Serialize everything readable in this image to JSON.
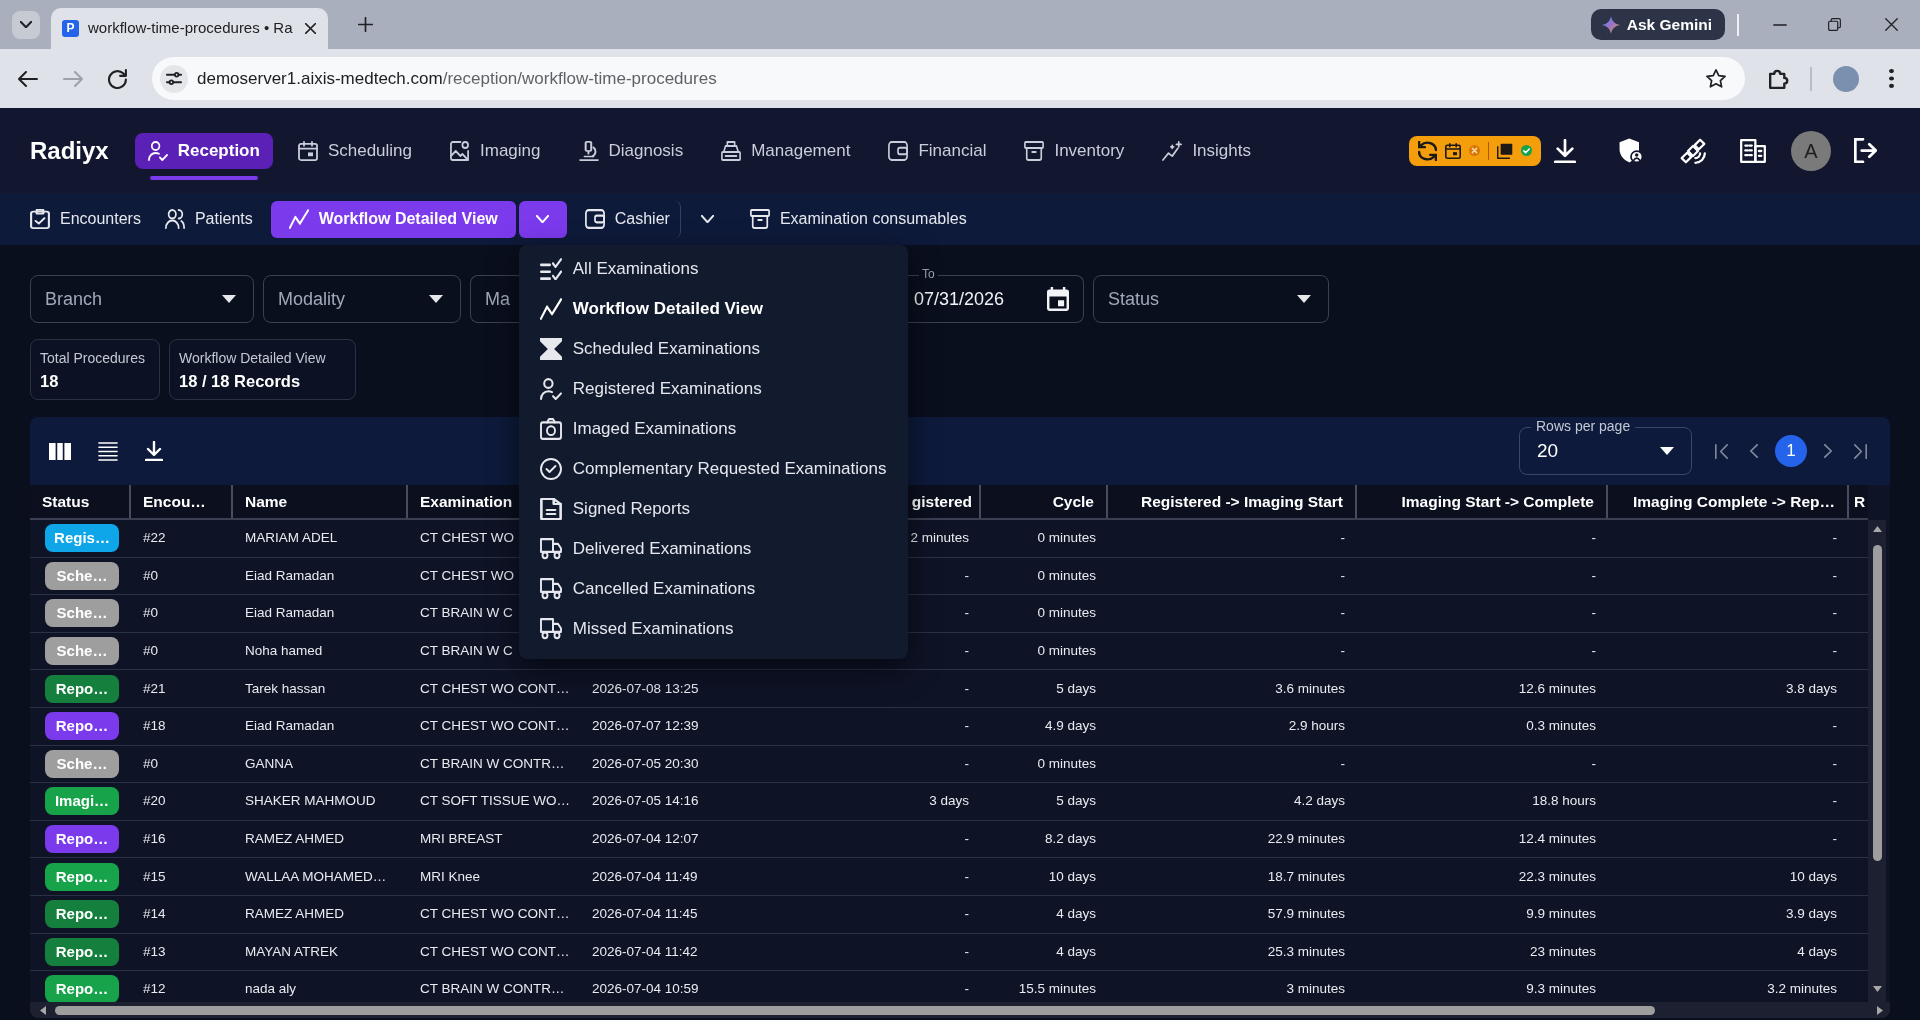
{
  "browser": {
    "tab": {
      "favicon": "P",
      "title": "workflow-time-procedures • Ra"
    },
    "assistant_button": "Ask Gemini",
    "nav_buttons": [
      {
        "kind": "back",
        "disabled": false
      },
      {
        "kind": "forward",
        "disabled": true
      },
      {
        "kind": "reload",
        "disabled": false
      }
    ],
    "address": {
      "host": "demoserver1.aixis-medtech.com",
      "path": "/reception/workflow-time-procedures"
    },
    "bookmarked": false
  },
  "app": {
    "brand": "Radiyx",
    "nav": [
      {
        "label": "Reception",
        "selected": true
      },
      {
        "label": "Scheduling",
        "selected": false
      },
      {
        "label": "Imaging",
        "selected": false
      },
      {
        "label": "Diagnosis",
        "selected": false
      },
      {
        "label": "Management",
        "selected": false
      },
      {
        "label": "Financial",
        "selected": false
      },
      {
        "label": "Inventory",
        "selected": false
      },
      {
        "label": "Insights",
        "selected": false
      }
    ],
    "service_status": [
      {
        "kind": "calendar",
        "ok": false
      },
      {
        "kind": "pdf",
        "ok": true
      }
    ],
    "user_initial": "A"
  },
  "subnav": [
    {
      "label": "Encounters",
      "kind": "link",
      "selected": false
    },
    {
      "label": "Patients",
      "kind": "link",
      "selected": false
    },
    {
      "label": "Workflow Detailed View",
      "kind": "split",
      "selected": true,
      "expanded": true,
      "menu": [
        {
          "label": "All Examinations",
          "selected": false
        },
        {
          "label": "Workflow Detailed View",
          "selected": true
        },
        {
          "label": "Scheduled Examinations",
          "selected": false
        },
        {
          "label": "Registered Examinations",
          "selected": false
        },
        {
          "label": "Imaged Examinations",
          "selected": false
        },
        {
          "label": "Complementary Requested Examinations",
          "selected": false
        },
        {
          "label": "Signed Reports",
          "selected": false
        },
        {
          "label": "Delivered Examinations",
          "selected": false
        },
        {
          "label": "Cancelled Examinations",
          "selected": false
        },
        {
          "label": "Missed Examinations",
          "selected": false
        }
      ]
    },
    {
      "label": "Cashier",
      "kind": "split",
      "selected": false,
      "expanded": false
    },
    {
      "label": "Examination consumables",
      "kind": "link",
      "selected": false
    }
  ],
  "filters": [
    {
      "kind": "select",
      "placeholder": "Branch"
    },
    {
      "kind": "select",
      "placeholder": "Modality"
    },
    {
      "kind": "select",
      "placeholder": "Ma"
    },
    {
      "kind": "date",
      "label": "To",
      "value": "07/31/2026"
    },
    {
      "kind": "select",
      "placeholder": "Status"
    }
  ],
  "summary": [
    {
      "label": "Total Procedures",
      "value": "18"
    },
    {
      "label": "Workflow Detailed View",
      "value": "18 / 18 Records"
    }
  ],
  "table": {
    "rows_per_page": {
      "label": "Rows per page",
      "value": "20"
    },
    "pages": [
      {
        "label": "1",
        "selected": true
      }
    ],
    "header": {
      "status": "Status",
      "encounter": "Encou…",
      "name": "Name",
      "examination": "Examination",
      "column_6": "gistered",
      "cycle": "Cycle",
      "registered_imaging_start": "Registered -> Imaging Start",
      "imaging_start_complete": "Imaging Start -> Complete",
      "imaging_complete_rep": "Imaging Complete -> Rep…",
      "column_11": "R"
    },
    "rows": [
      {
        "status": {
          "label": "Regis…",
          "color": "#0ea5e9"
        },
        "encounter": "#22",
        "name": "MARIAM ADEL",
        "examination": "CT CHEST WO",
        "column_6": "2 minutes",
        "cycle": "0 minutes",
        "registered_imaging_start": "-",
        "imaging_start_complete": "-",
        "imaging_complete_rep": "-"
      },
      {
        "status": {
          "label": "Sche…",
          "color": "#9e9e9e"
        },
        "encounter": "#0",
        "name": "Eiad Ramadan",
        "examination": "CT CHEST WO",
        "column_6": "-",
        "cycle": "0 minutes",
        "registered_imaging_start": "-",
        "imaging_start_complete": "-",
        "imaging_complete_rep": "-"
      },
      {
        "status": {
          "label": "Sche…",
          "color": "#9e9e9e"
        },
        "encounter": "#0",
        "name": "Eiad Ramadan",
        "examination": "CT BRAIN W C",
        "column_6": "-",
        "cycle": "0 minutes",
        "registered_imaging_start": "-",
        "imaging_start_complete": "-",
        "imaging_complete_rep": "-"
      },
      {
        "status": {
          "label": "Sche…",
          "color": "#9e9e9e"
        },
        "encounter": "#0",
        "name": "Noha hamed",
        "examination": "CT BRAIN W C",
        "column_6": "-",
        "cycle": "0 minutes",
        "registered_imaging_start": "-",
        "imaging_start_complete": "-",
        "imaging_complete_rep": "-"
      },
      {
        "status": {
          "label": "Repo…",
          "color": "#15803d"
        },
        "encounter": "#21",
        "name": "Tarek hassan",
        "examination": "CT CHEST WO CONT…",
        "column_5": "2026-07-08 13:25",
        "column_6": "-",
        "cycle": "5 days",
        "registered_imaging_start": "3.6 minutes",
        "imaging_start_complete": "12.6 minutes",
        "imaging_complete_rep": "3.8 days"
      },
      {
        "status": {
          "label": "Repo…",
          "color": "#7c3aed"
        },
        "encounter": "#18",
        "name": "Eiad Ramadan",
        "examination": "CT CHEST WO CONT…",
        "column_5": "2026-07-07 12:39",
        "column_6": "-",
        "cycle": "4.9 days",
        "registered_imaging_start": "2.9 hours",
        "imaging_start_complete": "0.3 minutes",
        "imaging_complete_rep": "-"
      },
      {
        "status": {
          "label": "Sche…",
          "color": "#9e9e9e"
        },
        "encounter": "#0",
        "name": "GANNA",
        "examination": "CT BRAIN W CONTR…",
        "column_5": "2026-07-05 20:30",
        "column_6": "-",
        "cycle": "0 minutes",
        "registered_imaging_start": "-",
        "imaging_start_complete": "-",
        "imaging_complete_rep": "-"
      },
      {
        "status": {
          "label": "Imagi…",
          "color": "#16a34a"
        },
        "encounter": "#20",
        "name": "SHAKER MAHMOUD",
        "examination": "CT SOFT TISSUE WO…",
        "column_5": "2026-07-05 14:16",
        "column_6": "3 days",
        "cycle": "5 days",
        "registered_imaging_start": "4.2 days",
        "imaging_start_complete": "18.8 hours",
        "imaging_complete_rep": "-"
      },
      {
        "status": {
          "label": "Repo…",
          "color": "#7c3aed"
        },
        "encounter": "#16",
        "name": "RAMEZ AHMED",
        "examination": "MRI BREAST",
        "column_5": "2026-07-04 12:07",
        "column_6": "-",
        "cycle": "8.2 days",
        "registered_imaging_start": "22.9 minutes",
        "imaging_start_complete": "12.4 minutes",
        "imaging_complete_rep": "-"
      },
      {
        "status": {
          "label": "Repo…",
          "color": "#16a34a"
        },
        "encounter": "#15",
        "name": "WALLAA MOHAMED…",
        "examination": "MRI Knee",
        "column_5": "2026-07-04 11:49",
        "column_6": "-",
        "cycle": "10 days",
        "registered_imaging_start": "18.7 minutes",
        "imaging_start_complete": "22.3 minutes",
        "imaging_complete_rep": "10 days"
      },
      {
        "status": {
          "label": "Repo…",
          "color": "#15803d"
        },
        "encounter": "#14",
        "name": "RAMEZ AHMED",
        "examination": "CT CHEST WO CONT…",
        "column_5": "2026-07-04 11:45",
        "column_6": "-",
        "cycle": "4 days",
        "registered_imaging_start": "57.9 minutes",
        "imaging_start_complete": "9.9 minutes",
        "imaging_complete_rep": "3.9 days"
      },
      {
        "status": {
          "label": "Repo…",
          "color": "#15803d"
        },
        "encounter": "#13",
        "name": "MAYAN ATREK",
        "examination": "CT CHEST WO CONT…",
        "column_5": "2026-07-04 11:42",
        "column_6": "-",
        "cycle": "4 days",
        "registered_imaging_start": "25.3 minutes",
        "imaging_start_complete": "23 minutes",
        "imaging_complete_rep": "4 days"
      },
      {
        "status": {
          "label": "Repo…",
          "color": "#16a34a"
        },
        "encounter": "#12",
        "name": "nada aly",
        "examination": "CT BRAIN W CONTR…",
        "column_5": "2026-07-04 10:59",
        "column_6": "-",
        "cycle": "15.5 minutes",
        "registered_imaging_start": "3 minutes",
        "imaging_start_complete": "9.3 minutes",
        "imaging_complete_rep": "3.2 minutes"
      }
    ]
  }
}
